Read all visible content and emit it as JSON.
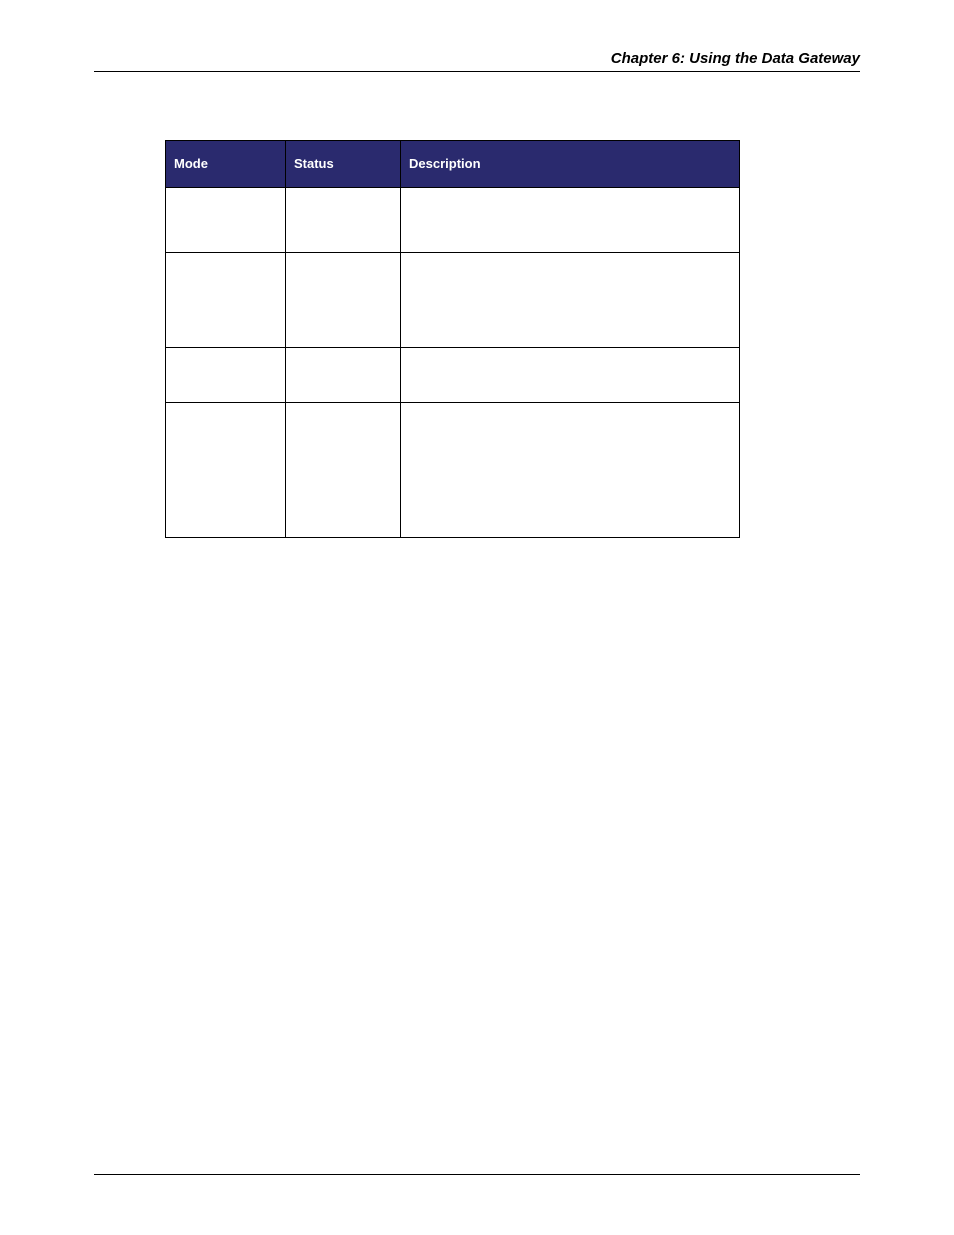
{
  "header": {
    "title": "Chapter 6: Using the Data Gateway"
  },
  "table": {
    "headers": [
      "Mode",
      "Status",
      "Description"
    ],
    "rows": [
      [
        "",
        "",
        ""
      ],
      [
        "",
        "",
        ""
      ],
      [
        "",
        "",
        ""
      ],
      [
        "",
        "",
        ""
      ]
    ]
  }
}
